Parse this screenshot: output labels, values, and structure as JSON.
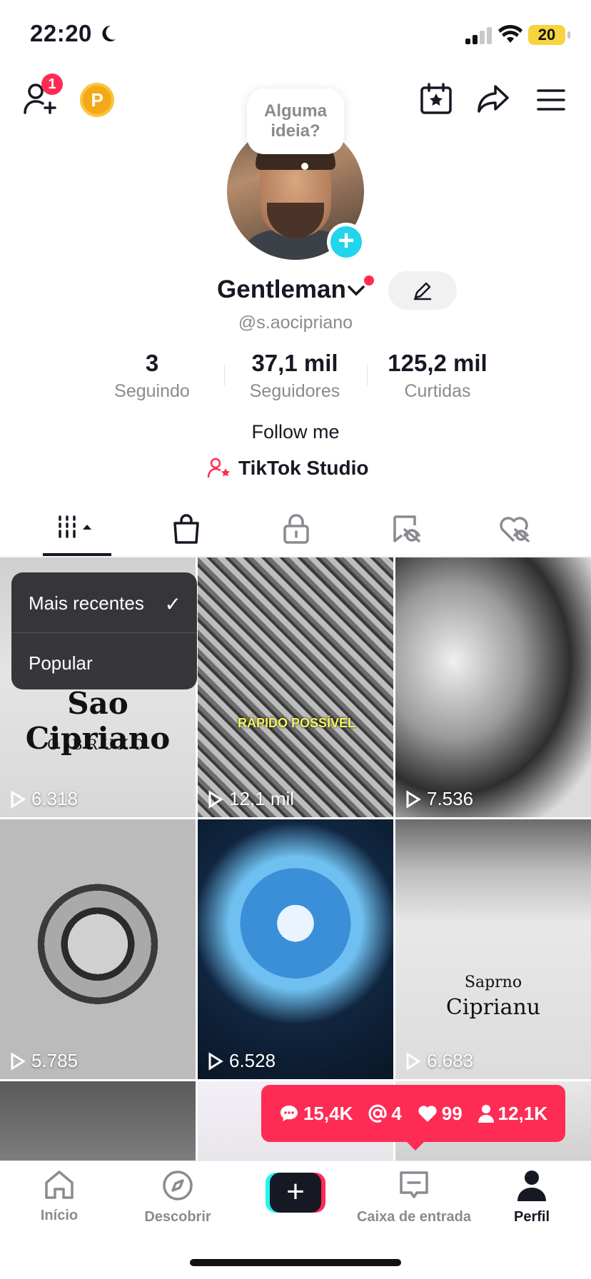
{
  "status_bar": {
    "time": "22:20",
    "battery": "20"
  },
  "header": {
    "friend_badge": "1",
    "coin_letter": "P",
    "bubble_text": "Alguma ideia?"
  },
  "profile": {
    "name": "Gentleman",
    "handle": "@s.aocipriano",
    "bio": "Follow me",
    "studio_label": "TikTok Studio"
  },
  "stats": [
    {
      "value": "3",
      "label": "Seguindo"
    },
    {
      "value": "37,1 mil",
      "label": "Seguidores"
    },
    {
      "value": "125,2 mil",
      "label": "Curtidas"
    }
  ],
  "sort_menu": {
    "items": [
      "Mais recentes",
      "Popular"
    ],
    "selected": "Mais recentes"
  },
  "videos": [
    {
      "views": "6.318",
      "title_line1": "Sao Cipriano",
      "title_line2": "O BRUXO"
    },
    {
      "views": "12,1 mil",
      "overlay": "RÁPIDO POSSÍVEL"
    },
    {
      "views": "7.536"
    },
    {
      "views": "5.785"
    },
    {
      "views": "6.528"
    },
    {
      "views": "6.683",
      "title_line1": "Saprno",
      "title_line2": "Ciprianu"
    },
    {
      "views": ""
    },
    {
      "views": ""
    },
    {
      "views": ""
    }
  ],
  "notification": {
    "comments": "15,4K",
    "mentions": "4",
    "likes": "99",
    "followers": "12,1K"
  },
  "bottom_nav": [
    {
      "label": "Início",
      "icon": "home-icon"
    },
    {
      "label": "Descobrir",
      "icon": "compass-icon"
    },
    {
      "label": "",
      "icon": "plus-icon"
    },
    {
      "label": "Caixa de entrada",
      "icon": "inbox-icon"
    },
    {
      "label": "Perfil",
      "icon": "profile-icon"
    }
  ],
  "colors": {
    "accent": "#fe2c55",
    "cyan": "#20d5ec",
    "muted": "#8a8b91"
  }
}
